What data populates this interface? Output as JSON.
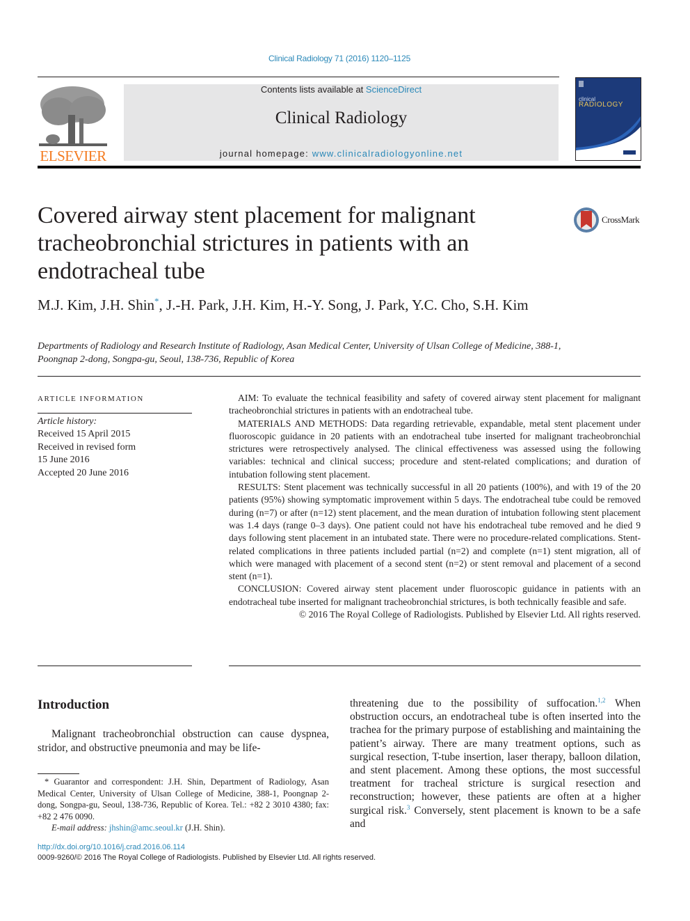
{
  "header": {
    "journal_ref": "Clinical Radiology 71 (2016) 1120–1125",
    "contents_prefix": "Contents lists available at ",
    "contents_link": "ScienceDirect",
    "journal_name": "Clinical Radiology",
    "homepage_prefix": "journal homepage: ",
    "homepage_link": "www.clinicalradiologyonline.net",
    "publisher_logo_text": "ELSEVIER",
    "cover_small": "clinical",
    "cover_title": "RADIOLOGY",
    "publisher_color": "#f47b20",
    "cover_color": "#1c3a7a"
  },
  "article": {
    "title": "Covered airway stent placement for malignant tracheobronchial strictures in patients with an endotracheal tube",
    "crossmark_label": "CrossMark",
    "authors_before": "M.J. Kim, J.H. Shin",
    "author_mark": "*",
    "authors_after": ", J.-H. Park, J.H. Kim, H.-Y. Song, J. Park, Y.C. Cho, S.H. Kim",
    "affiliation": "Departments of Radiology and Research Institute of Radiology, Asan Medical Center, University of Ulsan College of Medicine, 388-1, Poongnap 2-dong, Songpa-gu, Seoul, 138-736, Republic of Korea"
  },
  "article_info": {
    "heading": "ARTICLE INFORMATION",
    "history_label": "Article history:",
    "history": [
      "Received 15 April 2015",
      "Received in revised form",
      "15 June 2016",
      "Accepted 20 June 2016"
    ]
  },
  "abstract": {
    "aim": "AIM: To evaluate the technical feasibility and safety of covered airway stent placement for malignant tracheobronchial strictures in patients with an endotracheal tube.",
    "methods": "MATERIALS AND METHODS: Data regarding retrievable, expandable, metal stent placement under fluoroscopic guidance in 20 patients with an endotracheal tube inserted for malignant tracheobronchial strictures were retrospectively analysed. The clinical effectiveness was assessed using the following variables: technical and clinical success; procedure and stent-related complications; and duration of intubation following stent placement.",
    "results": "RESULTS: Stent placement was technically successful in all 20 patients (100%), and with 19 of the 20 patients (95%) showing symptomatic improvement within 5 days. The endotracheal tube could be removed during (n=7) or after (n=12) stent placement, and the mean duration of intubation following stent placement was 1.4 days (range 0–3 days). One patient could not have his endotracheal tube removed and he died 9 days following stent placement in an intubated state. There were no procedure-related complications. Stent-related complications in three patients included partial (n=2) and complete (n=1) stent migration, all of which were managed with placement of a second stent (n=2) or stent removal and placement of a second stent (n=1).",
    "conclusion": "CONCLUSION: Covered airway stent placement under fluoroscopic guidance in patients with an endotracheal tube inserted for malignant tracheobronchial strictures, is both technically feasible and safe.",
    "copyright": "© 2016 The Royal College of Radiologists. Published by Elsevier Ltd. All rights reserved."
  },
  "introduction": {
    "heading": "Introduction",
    "left_text": "Malignant tracheobronchial obstruction can cause dyspnea, stridor, and obstructive pneumonia and may be life-",
    "right_part1": "threatening due to the possibility of suffocation.",
    "ref1": "1,2",
    "right_part2": " When obstruction occurs, an endotracheal tube is often inserted into the trachea for the primary purpose of establishing and maintaining the patient’s airway. There are many treatment options, such as surgical resection, T-tube insertion, laser therapy, balloon dilation, and stent placement. Among these options, the most successful treatment for tracheal stricture is surgical resection and reconstruction; however, these patients are often at a higher surgical risk.",
    "ref2": "3",
    "right_part3": " Conversely, stent placement is known to be a safe and"
  },
  "footnote": {
    "mark": "*",
    "text": " Guarantor and correspondent: J.H. Shin, Department of Radiology, Asan Medical Center, University of Ulsan College of Medicine, 388-1, Poongnap 2-dong, Songpa-gu, Seoul, 138-736, Republic of Korea. Tel.: +82 2 3010 4380; fax: +82 2 476 0090.",
    "email_label": "E-mail address: ",
    "email": "jhshin@amc.seoul.kr",
    "email_after": " (J.H. Shin)."
  },
  "footer": {
    "doi": "http://dx.doi.org/10.1016/j.crad.2016.06.114",
    "issn": "0009-9260/© 2016 The Royal College of Radiologists. Published by Elsevier Ltd. All rights reserved."
  }
}
